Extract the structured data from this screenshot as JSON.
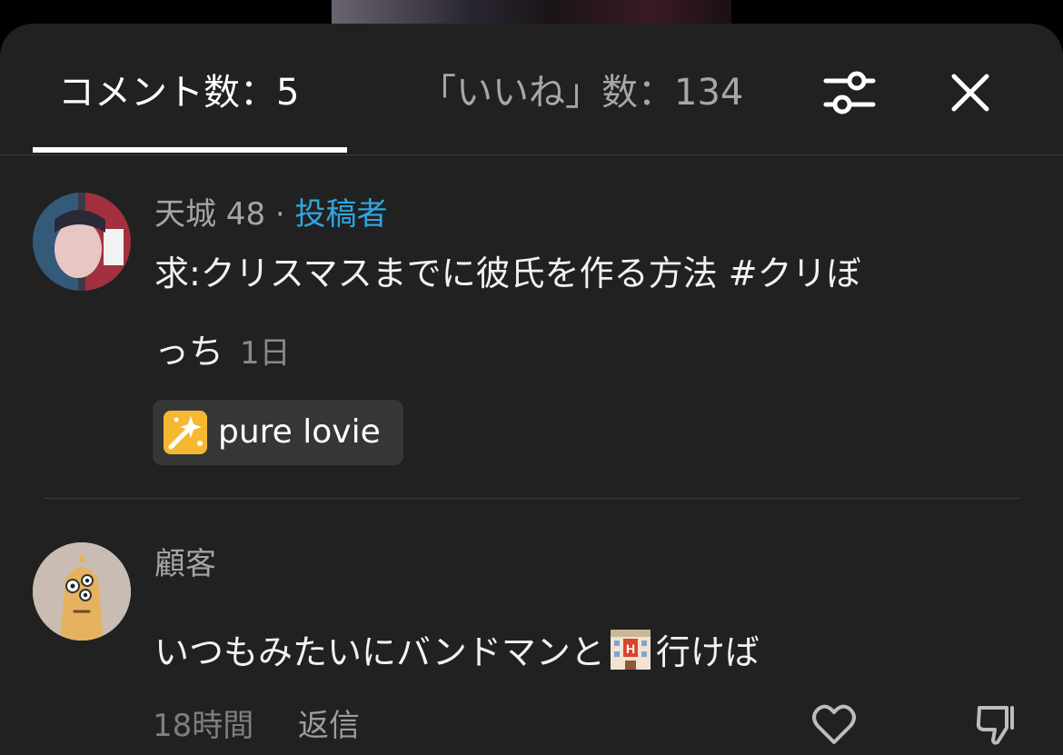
{
  "tabs": {
    "comments_label": "コメント数：5",
    "likes_label": "「いいね」数：134"
  },
  "icons": {
    "filter": "sliders-icon",
    "close": "close-icon",
    "like": "heart-icon",
    "dislike": "thumbs-down-icon",
    "chip": "sparkle-icon",
    "emoji": "hotel-emoji-icon"
  },
  "colors": {
    "background": "#212121",
    "author_tag": "#2fa6df",
    "chip_bg": "#363636",
    "chip_icon": "#f6b830"
  },
  "comments": [
    {
      "username": "天城 48",
      "separator": " · ",
      "author_tag": "投稿者",
      "text_line1": "求:クリスマスまでに彼氏を作る方法 #クリぼ",
      "text_line2": "っち",
      "time": "1日",
      "chip_label": "pure lovie"
    },
    {
      "username": "顧客",
      "text_before_emoji": "いつもみたいにバンドマンと",
      "text_after_emoji": "行けば",
      "time": "18時間",
      "reply_label": "返信"
    }
  ]
}
